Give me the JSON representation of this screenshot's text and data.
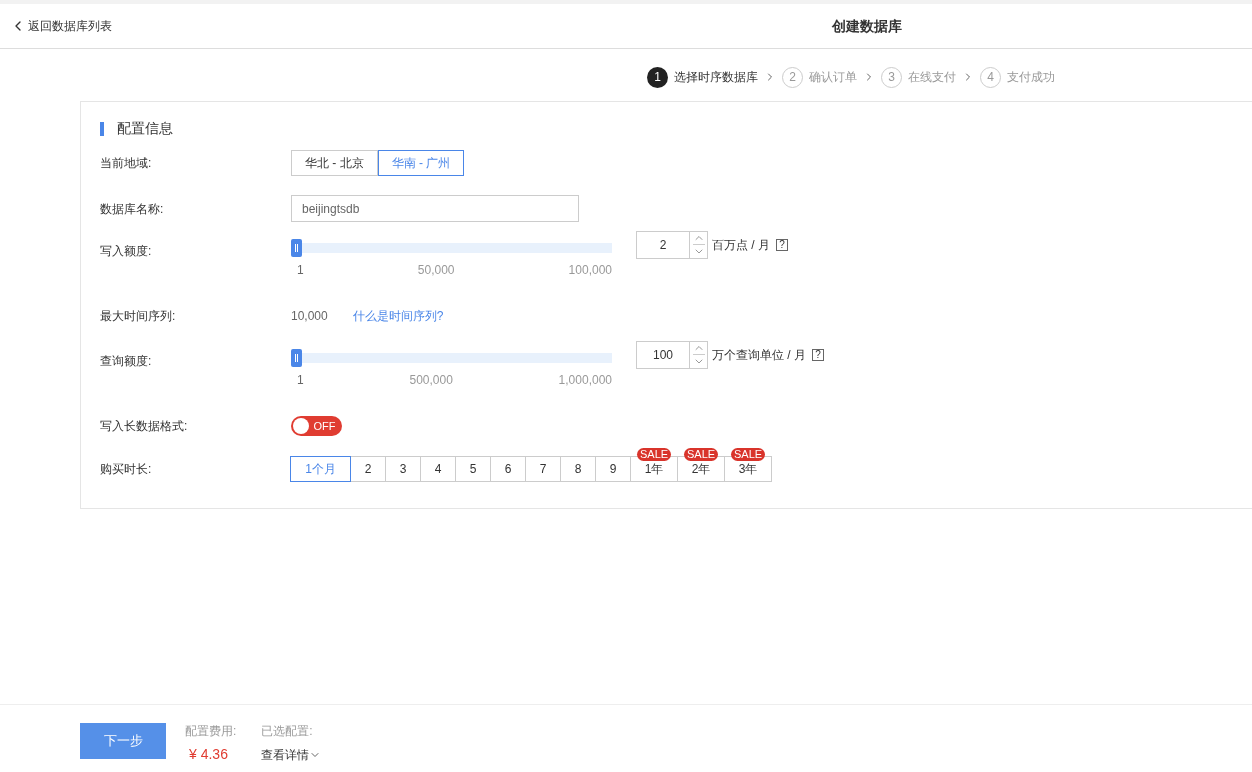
{
  "header": {
    "back_link": "返回数据库列表",
    "title": "创建数据库"
  },
  "steps": [
    {
      "number": "1",
      "label": "选择时序数据库",
      "selected": true
    },
    {
      "number": "2",
      "label": "确认订单",
      "selected": false
    },
    {
      "number": "3",
      "label": "在线支付",
      "selected": false
    },
    {
      "number": "4",
      "label": "支付成功",
      "selected": false
    }
  ],
  "section_title": "配置信息",
  "region": {
    "label": "当前地域:",
    "options": [
      {
        "label": "华北 - 北京",
        "selected": false
      },
      {
        "label": "华南 - 广州",
        "selected": true
      }
    ]
  },
  "db_name": {
    "label": "数据库名称:",
    "value": "beijingtsdb"
  },
  "write_quota": {
    "label": "写入额度:",
    "level": 0,
    "ticks": [
      "1",
      "50,000",
      "100,000"
    ],
    "value": "2",
    "unit": "百万点 / 月",
    "help": "?"
  },
  "max_series": {
    "label": "最大时间序列:",
    "value": "10,000",
    "link": "什么是时间序列?"
  },
  "query_quota": {
    "label": "查询额度:",
    "level": 0,
    "ticks": [
      "1",
      "500,000",
      "1,000,000"
    ],
    "value": "100",
    "unit": "万个查询单位 / 月",
    "help": "?"
  },
  "long_format": {
    "label": "写入长数据格式:",
    "on": false,
    "state_text": "OFF"
  },
  "duration": {
    "label": "购买时长:",
    "options": [
      {
        "label": "1个月",
        "selected": true
      },
      {
        "label": "2",
        "selected": false
      },
      {
        "label": "3",
        "selected": false
      },
      {
        "label": "4",
        "selected": false
      },
      {
        "label": "5",
        "selected": false
      },
      {
        "label": "6",
        "selected": false
      },
      {
        "label": "7",
        "selected": false
      },
      {
        "label": "8",
        "selected": false
      },
      {
        "label": "9",
        "selected": false
      },
      {
        "label": "1年",
        "selected": false,
        "badge": "SALE"
      },
      {
        "label": "2年",
        "selected": false,
        "badge": "SALE"
      },
      {
        "label": "3年",
        "selected": false,
        "badge": "SALE"
      }
    ]
  },
  "footer": {
    "next_button": "下一步",
    "cost_label": "配置费用:",
    "cost": "¥ 4.36",
    "config_label": "已选配置:",
    "details_link": "查看详情"
  }
}
